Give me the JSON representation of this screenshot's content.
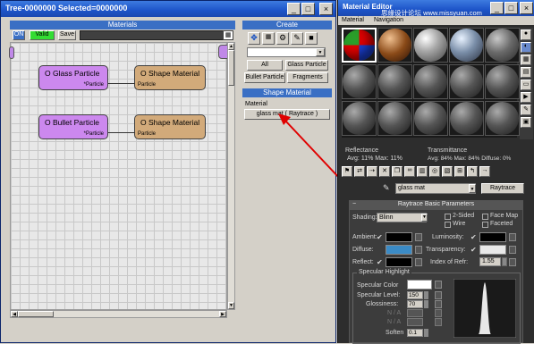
{
  "tree_window": {
    "title": "Tree-0000000  Selected=0000000",
    "materials_header": "Materials",
    "toolbar": {
      "on_label": "ON",
      "valid_label": "Valid",
      "save_label": "Save"
    },
    "nodes": [
      {
        "title": "O Glass Particle",
        "sub": "*Particle"
      },
      {
        "title": "O Shape Material",
        "sub": "Particle"
      },
      {
        "title": "O Bullet Particle",
        "sub": "*Particle"
      },
      {
        "title": "O Shape Material",
        "sub": "Particle"
      }
    ],
    "create_header": "Create",
    "create_buttons": [
      "All",
      "Glass Particle",
      "Bullet Particle",
      "Fragments"
    ],
    "shape_material_header": "Shape Material",
    "material_label": "Material",
    "material_value": "glass mat ( Raytrace )",
    "colors": {
      "particle_node": "#cc88ee",
      "material_node": "#d2aa7a",
      "header": "#3a6fc4"
    }
  },
  "material_window": {
    "title": "Material Editor",
    "menu": [
      "Material",
      "Navigation"
    ],
    "watermark": "思缘设计论坛  www.missyuan.com",
    "reflectance_label": "Reflectance",
    "reflectance_avg": "Avg:  11% Max:  11%",
    "transmittance_label": "Transmittance",
    "transmittance_avg": "Avg:  84% Max:  84% Diffuse:  0%",
    "material_name": "glass mat",
    "material_type": "Raytrace",
    "rollout_title": "Raytrace Basic Parameters",
    "shading_label": "Shading:",
    "shading_value": "Blinn",
    "two_sided": "2-Sided",
    "face_map": "Face Map",
    "wire": "Wire",
    "faceted": "Faceted",
    "ambient_label": "Ambient:",
    "diffuse_label": "Diffuse:",
    "reflect_label": "Reflect:",
    "luminosity_label": "Luminosity:",
    "transparency_label": "Transparency:",
    "ior_label": "Index of Refr:",
    "ior_value": "1.55",
    "spec_group": "Specular Highlight",
    "spec_color_label": "Specular Color",
    "spec_level_label": "Specular Level:",
    "spec_level_value": "150",
    "glossiness_label": "Glossiness:",
    "glossiness_value": "70",
    "aniso_label": "N / A",
    "orient_label": "N / A",
    "soften_label": "Soften",
    "soften_value": "0.1"
  }
}
